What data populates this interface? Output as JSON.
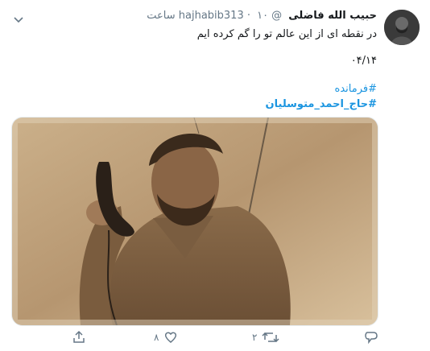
{
  "tweet": {
    "author_name": "حبیب الله فاضلی",
    "handle": "@hajhabib313",
    "separator": "·",
    "time": "۱۰ ساعت",
    "text_line1": "در نقطه ای از این عالم تو را گم کرده ایم",
    "text_line2": "۰۴/۱۴",
    "hashtag1": "#فرمانده",
    "hashtag2": "#حاج_احمد_متوسلیان"
  },
  "actions": {
    "like_count": "۸",
    "retweet_count": "۲",
    "reply_count": ""
  },
  "icons": {
    "caret": "chevron-down-icon",
    "share": "share-icon",
    "like": "heart-icon",
    "retweet": "retweet-icon",
    "reply": "reply-icon"
  },
  "colors": {
    "link": "#1b95e0",
    "muted": "#657786",
    "text": "#14171a"
  }
}
